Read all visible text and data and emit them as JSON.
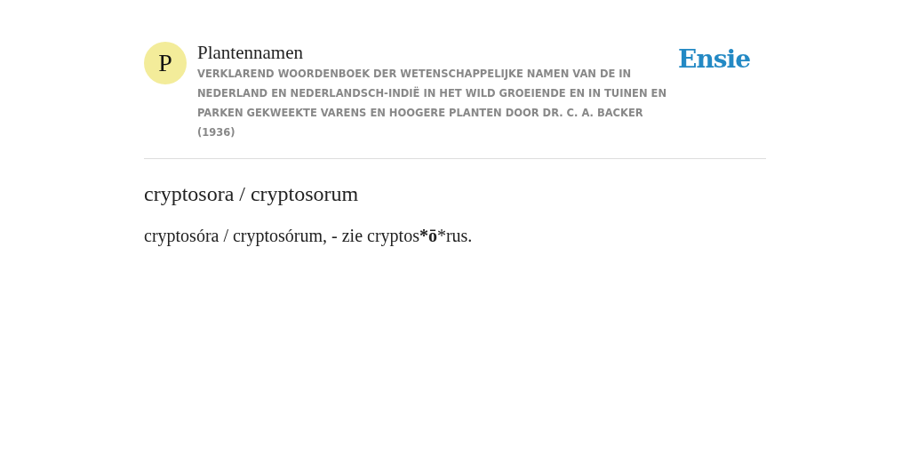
{
  "header": {
    "logo_letter": "P",
    "title": "Plantennamen",
    "subtitle": "VERKLAREND WOORDENBOEK DER WETENSCHAPPELIJKE NAMEN VAN DE IN NEDERLAND EN NEDERLANDSCH-INDIË IN HET WILD GROEIENDE EN IN TUINEN EN PARKEN GEKWEEKTE VARENS EN HOOGERE PLANTEN DOOR DR. C. A. BACKER (1936)",
    "brand": "Ensie"
  },
  "entry": {
    "heading": "cryptosora / cryptosorum",
    "definition": "cryptosóra / cryptosórum, - zie cryptos***ō***rus."
  }
}
